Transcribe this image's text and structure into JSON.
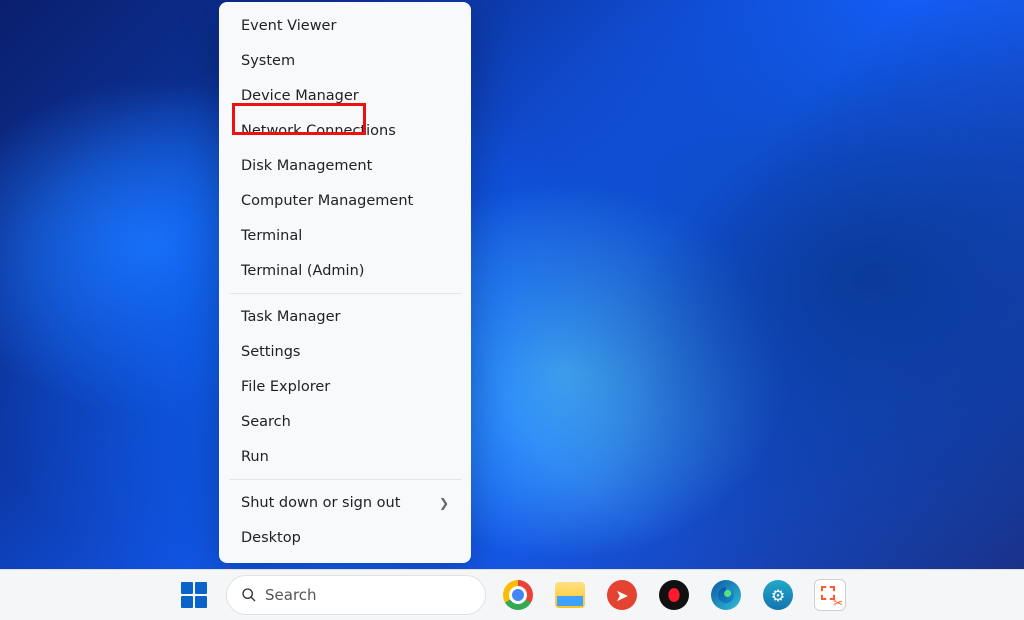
{
  "winx_menu": {
    "groups": [
      [
        {
          "label": "Event Viewer"
        },
        {
          "label": "System"
        },
        {
          "label": "Device Manager",
          "highlighted": true
        },
        {
          "label": "Network Connections"
        },
        {
          "label": "Disk Management"
        },
        {
          "label": "Computer Management"
        },
        {
          "label": "Terminal"
        },
        {
          "label": "Terminal (Admin)"
        }
      ],
      [
        {
          "label": "Task Manager"
        },
        {
          "label": "Settings"
        },
        {
          "label": "File Explorer"
        },
        {
          "label": "Search"
        },
        {
          "label": "Run"
        }
      ],
      [
        {
          "label": "Shut down or sign out",
          "submenu": true
        },
        {
          "label": "Desktop"
        }
      ]
    ]
  },
  "taskbar": {
    "search_placeholder": "Search",
    "pinned": [
      {
        "name": "chrome-icon"
      },
      {
        "name": "file-explorer-icon"
      },
      {
        "name": "todoist-icon"
      },
      {
        "name": "opera-icon"
      },
      {
        "name": "edge-icon"
      },
      {
        "name": "settings-gear-icon"
      },
      {
        "name": "snipping-tool-icon"
      }
    ]
  },
  "annotation": {
    "highlight_item": "Device Manager"
  }
}
